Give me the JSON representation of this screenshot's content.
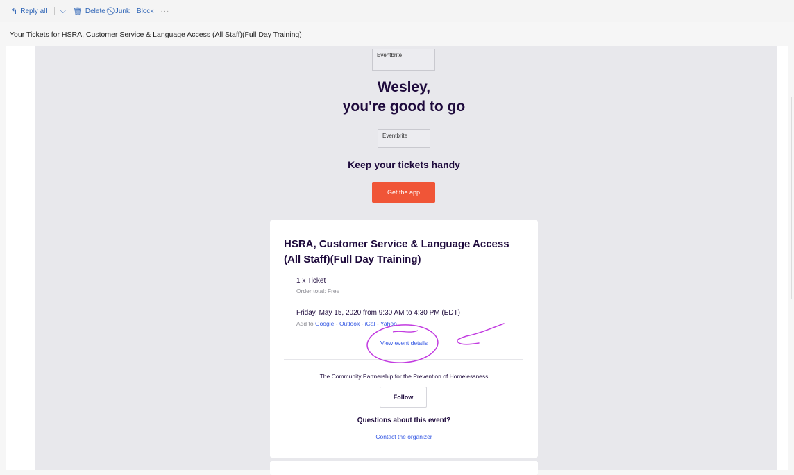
{
  "toolbar": {
    "reply_all": "Reply all",
    "delete": "Delete",
    "junk": "Junk",
    "block": "Block",
    "more": "···"
  },
  "email": {
    "subject": "Your Tickets for HSRA, Customer Service & Language Access (All Staff)(Full Day Training)"
  },
  "body": {
    "logo_alt_1": "Eventbrite",
    "greeting_line1": "Wesley,",
    "greeting_line2": "you're good to go",
    "logo_alt_2": "Eventbrite",
    "keep_tickets": "Keep your tickets handy",
    "get_app_label": "Get the app"
  },
  "event_card": {
    "title": "HSRA, Customer Service & Language Access (All Staff)(Full Day Training)",
    "ticket_count": "1 x Ticket",
    "order_total": "Order total: Free",
    "date_time": "Friday, May 15, 2020 from 9:30 AM to 4:30 PM (EDT)",
    "add_to_prefix": "Add to",
    "calendars": [
      "Google",
      "Outlook",
      "iCal",
      "Yahoo"
    ],
    "calendar_separator": " - ",
    "view_details": "View event details",
    "organizer_name": "The Community Partnership for the Prevention of Homelessness",
    "follow_label": "Follow",
    "questions_heading": "Questions about this event?",
    "contact_label": "Contact the organizer"
  },
  "colors": {
    "accent_orange": "#f05537",
    "link_blue": "#3659e3",
    "heading_navy": "#1e0a3c",
    "annotation_purple": "#c23be0",
    "toolbar_blue": "#2b62b5"
  },
  "icons": {
    "reply_all": "reply-all-icon",
    "chevron": "chevron-down-icon",
    "delete": "trash-icon",
    "junk": "junk-icon"
  }
}
